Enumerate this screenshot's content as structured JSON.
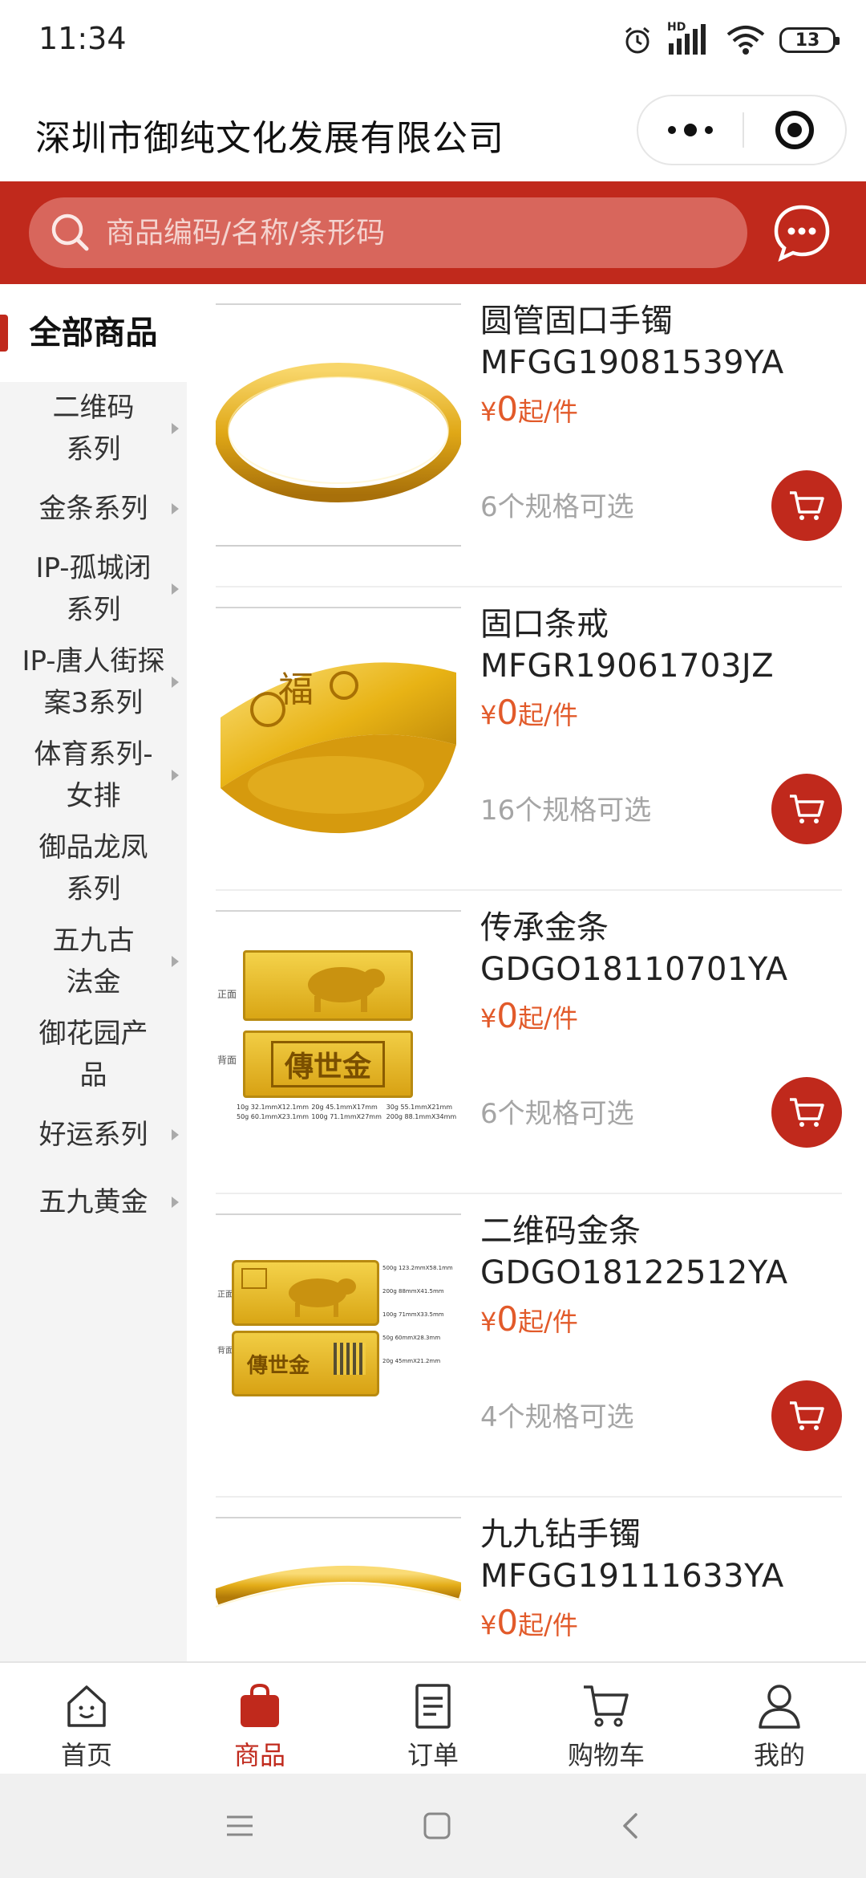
{
  "status_bar": {
    "time": "11:34",
    "network": "HD",
    "battery": "13",
    "icons": [
      "alarm-icon",
      "signal-icon",
      "wifi-icon",
      "battery-icon"
    ]
  },
  "title_bar": {
    "title": "深圳市御纯文化发展有限公司",
    "icons": [
      "more-icon",
      "close-miniprogram-icon"
    ]
  },
  "search": {
    "placeholder": "商品编码/名称/条形码",
    "icon": "search-icon",
    "chat_icon": "chat-icon"
  },
  "colors": {
    "brand": "#c0291c",
    "price": "#e25a2a",
    "search_bg": "#d8665c",
    "sidebar_bg": "#f4f4f4"
  },
  "sidebar": {
    "active": "全部商品",
    "items": [
      {
        "label": "二维码系列"
      },
      {
        "label": "金条系列"
      },
      {
        "label": "IP-孤城闭系列"
      },
      {
        "label": "IP-唐人街探案3系列"
      },
      {
        "label": "体育系列-女排"
      },
      {
        "label": "御品龙凤系列"
      },
      {
        "label": "五九古法金"
      },
      {
        "label": "御花园产品"
      },
      {
        "label": "好运系列"
      },
      {
        "label": "五九黄金"
      }
    ]
  },
  "products": [
    {
      "name": "圆管固口手镯",
      "code": "MFGG19081539YA",
      "currency": "¥",
      "price": "0",
      "unit": "起/件",
      "specs": "6个规格可选",
      "image": "bangle"
    },
    {
      "name": "固口条戒",
      "code": "MFGR19061703JZ",
      "currency": "¥",
      "price": "0",
      "unit": "起/件",
      "specs": "16个规格可选",
      "image": "ring"
    },
    {
      "name": "传承金条",
      "code": "GDGO18110701YA",
      "currency": "¥",
      "price": "0",
      "unit": "起/件",
      "specs": "6个规格可选",
      "image": "gold-bar",
      "image_text": {
        "front": "正面",
        "back": "背面",
        "stamp": "傳世金",
        "sizes": [
          "10g 32.1mmX12.1mm",
          "20g 45.1mmX17mm",
          "30g 55.1mmX21mm",
          "50g 60.1mmX23.1mm",
          "100g 71.1mmX27mm",
          "200g 88.1mmX34mm"
        ]
      }
    },
    {
      "name": "二维码金条",
      "code": "GDGO18122512YA",
      "currency": "¥",
      "price": "0",
      "unit": "起/件",
      "specs": "4个规格可选",
      "image": "qr-gold-bar",
      "image_text": {
        "front": "正面",
        "back": "背面",
        "stamp": "傳世金",
        "sizes": [
          "500g 123.2mmX58.1mm",
          "200g 88mmX41.5mm",
          "100g 71mmX33.5mm",
          "50g 60mmX28.3mm",
          "20g 45mmX21.2mm"
        ]
      }
    },
    {
      "name": "九九钻手镯",
      "code": "MFGG19111633YA",
      "currency": "¥",
      "price": "0",
      "unit": "起/件",
      "specs": "",
      "image": "bangle-2"
    }
  ],
  "tabs": [
    {
      "label": "首页",
      "icon": "home-icon"
    },
    {
      "label": "商品",
      "icon": "bag-icon"
    },
    {
      "label": "订单",
      "icon": "order-icon"
    },
    {
      "label": "购物车",
      "icon": "cart-icon"
    },
    {
      "label": "我的",
      "icon": "user-icon"
    }
  ],
  "active_tab": "商品",
  "system_nav": [
    "menu-icon",
    "home-square-icon",
    "back-icon"
  ]
}
